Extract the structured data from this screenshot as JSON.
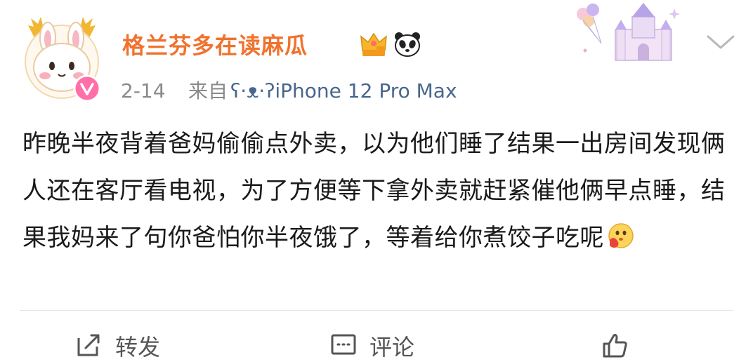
{
  "post": {
    "username": "格兰芬多在读麻瓜",
    "date": "2-14",
    "source_prefix": "来自",
    "source_device": "ʕ·ᴥ·ʔiPhone 12 Pro Max",
    "content": "昨晚半夜背着爸妈偷偷点外卖，以为他们睡了结果一出房间发现俩人还在客厅看电视，为了方便等下拿外卖就赶紧催他俩早点睡，结果我妈来了句你爸怕你半夜饿了，等着给你煮饺子吃呢"
  },
  "actions": {
    "repost_label": "转发",
    "comment_label": "评论",
    "like_label": ""
  },
  "colors": {
    "username": "#f0722e",
    "source_link": "#48668e",
    "meta": "#8a8a8a",
    "text": "#1a1a1a",
    "divider": "#e6e6e6"
  },
  "icons": {
    "avatar": "bunny-avatar",
    "verified_badge": "vip-badge-icon",
    "badge_1": "crown-icon",
    "badge_2": "panda-icon",
    "decoration": "castle-balloon-icon",
    "menu": "chevron-down-icon",
    "repost": "repost-icon",
    "comment": "comment-icon",
    "like": "thumbs-up-icon"
  }
}
